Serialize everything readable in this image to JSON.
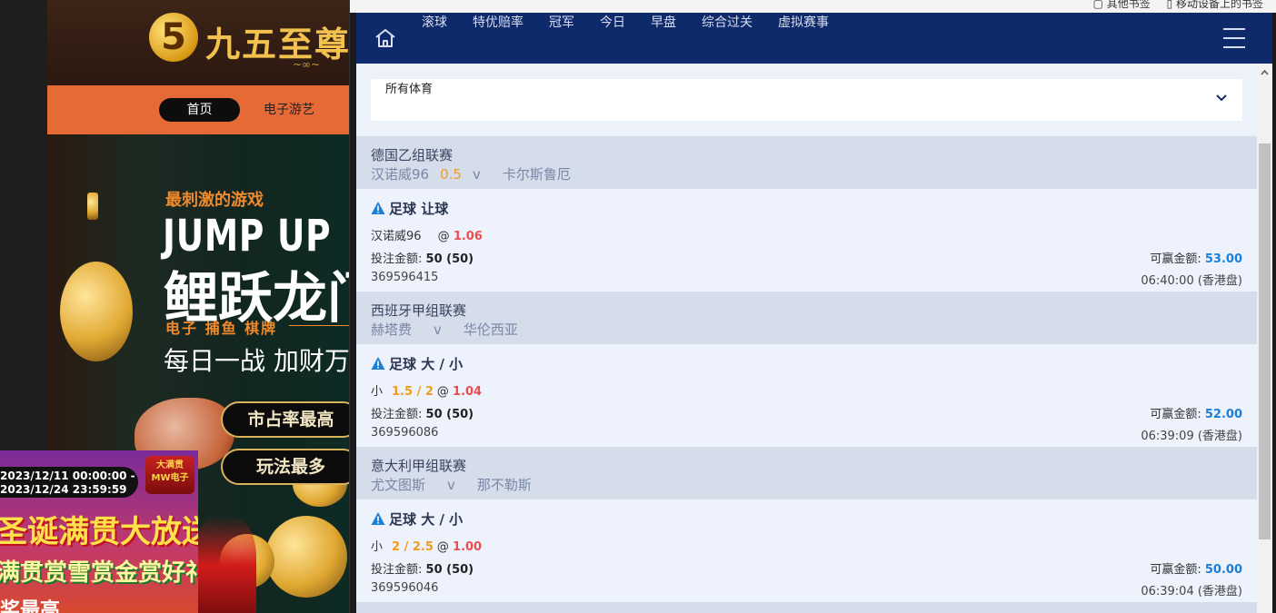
{
  "background_site": {
    "logo_mark": "5",
    "logo_text": "九五至尊",
    "nav": {
      "home": "首页",
      "games": "电子游艺"
    },
    "banner": {
      "subtitle": "最刺激的游戏",
      "title_en": "JUMP UP",
      "title_cn": "鲤跃龙门",
      "tags": "电子 捕鱼 棋牌",
      "slogan": "每日一战 加财万",
      "btn1": "市占率最高",
      "btn2": "玩法最多"
    },
    "promo": {
      "date_start": "2023/12/11 00:00:00 -",
      "date_end": "2023/12/24 23:59:59",
      "badge_top": "大满贯",
      "badge_bottom": "MW电子",
      "title": "圣诞满贯大放送",
      "subtitle": "满贯赏雪赏金赏好礼",
      "bottom": "奖最高"
    }
  },
  "top_links": {
    "a": "其他书签",
    "b": "移动设备上的书签"
  },
  "topnav": {
    "items": [
      "滚球",
      "特优赔率",
      "冠军",
      "今日",
      "早盘",
      "综合过关",
      "虚拟赛事"
    ]
  },
  "sport_select": {
    "value": "所有体育"
  },
  "bets": [
    {
      "league": "德国乙组联赛",
      "home": "汉诺威96",
      "handicap": "0.5",
      "vs": "v",
      "away": "卡尔斯鲁厄",
      "bet_type": "足球 让球",
      "selection": "汉诺威96",
      "sel_handicap": "",
      "odds": "1.06",
      "stake_label": "投注金额:",
      "stake": "50 (50)",
      "win_label": "可赢金额:",
      "win": "53.00",
      "id": "369596415",
      "time": "06:40:00 (香港盘)"
    },
    {
      "league": "西班牙甲组联赛",
      "home": "赫塔费",
      "handicap": "",
      "vs": "v",
      "away": "华伦西亚",
      "bet_type": "足球 大 / 小",
      "selection": "小",
      "sel_handicap": "1.5 / 2",
      "odds": "1.04",
      "stake_label": "投注金额:",
      "stake": "50 (50)",
      "win_label": "可赢金额:",
      "win": "52.00",
      "id": "369596086",
      "time": "06:39:09 (香港盘)"
    },
    {
      "league": "意大利甲组联赛",
      "home": "尤文图斯",
      "handicap": "",
      "vs": "v",
      "away": "那不勒斯",
      "bet_type": "足球 大 / 小",
      "selection": "小",
      "sel_handicap": "2 / 2.5",
      "odds": "1.00",
      "stake_label": "投注金额:",
      "stake": "50 (50)",
      "win_label": "可赢金额:",
      "win": "50.00",
      "id": "369596046",
      "time": "06:39:04 (香港盘)"
    }
  ],
  "colors": {
    "nav_bg": "#0f2a6b",
    "league_bg": "#d5dcea",
    "handicap": "#f39a1e",
    "odds": "#e94e4e",
    "win": "#1b7fd8",
    "warning": "#1b7fd8"
  }
}
